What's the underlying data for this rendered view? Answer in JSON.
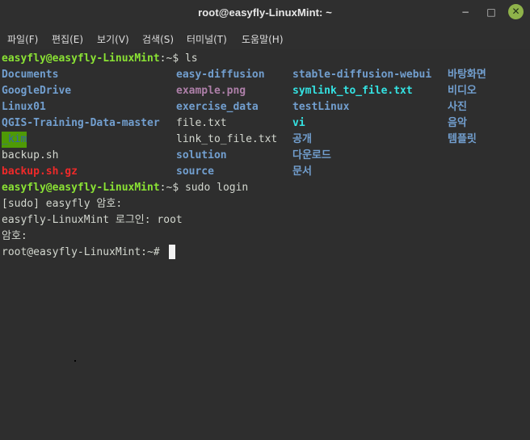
{
  "window": {
    "title": "root@easyfly-LinuxMint: ~",
    "controls": {
      "minimize": "−",
      "maximize": "□",
      "close": "✕"
    }
  },
  "menu": [
    "파일(F)",
    "편집(E)",
    "보기(V)",
    "검색(S)",
    "터미널(T)",
    "도움말(H)"
  ],
  "terminal": {
    "prompt_user": "easyfly@easyfly-LinuxMint",
    "prompt_sep": ":~$",
    "cmd_ls": " ls",
    "cmd_login": " sudo login",
    "ls_col1": [
      "Documents",
      "GoogleDrive",
      "Linux01",
      "QGIS-Training-Data-master",
      "_kim",
      "backup.sh",
      "backup.sh.gz"
    ],
    "ls_col2": [
      "easy-diffusion",
      "example.png",
      "exercise_data",
      "file.txt",
      "link_to_file.txt",
      "solution",
      "source"
    ],
    "ls_col3": [
      "stable-diffusion-webui",
      "symlink_to_file.txt",
      "testLinux",
      "vi",
      "공개",
      "다운로드",
      "문서"
    ],
    "ls_col4": [
      "바탕화면",
      "비디오",
      "사진",
      "음악",
      "템플릿"
    ],
    "sudo_prompt": "[sudo] easyfly 암호:",
    "login_prompt": "easyfly-LinuxMint 로그인: root",
    "password_prompt": "암호:",
    "root_prompt": "root@easyfly-LinuxMint:~#"
  },
  "colors": {
    "background": "#2e2e2e",
    "prompt": "#8ae234",
    "directory": "#729fcf",
    "image": "#ad7fa8",
    "symlink": "#34e2e2",
    "archive": "#ef2929",
    "text": "#d3d7cf"
  }
}
